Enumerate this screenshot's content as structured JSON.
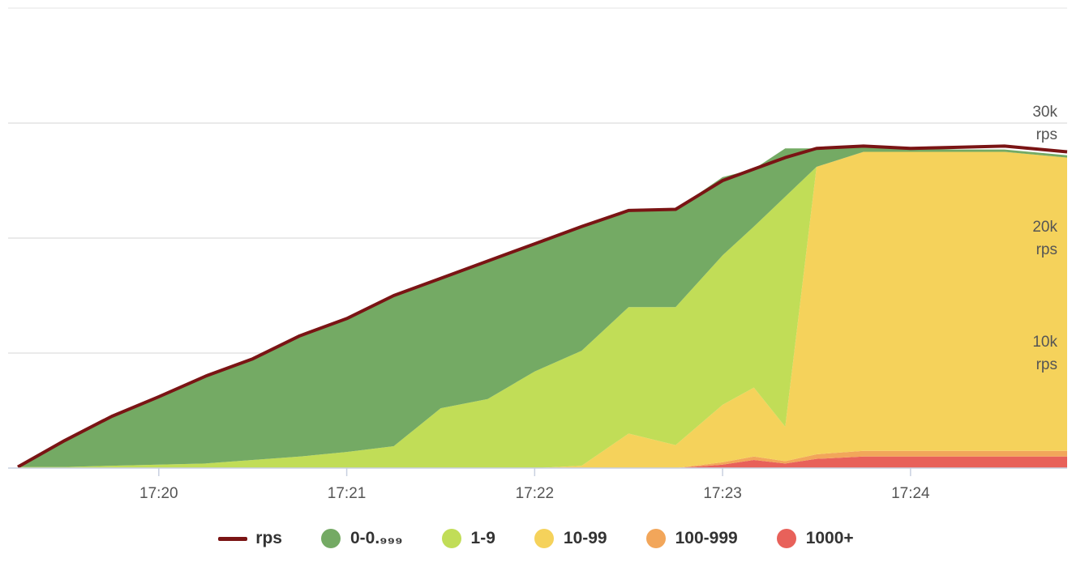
{
  "chart_data": {
    "type": "area",
    "stacked": true,
    "x_ticks": [
      "17:20",
      "17:21",
      "17:22",
      "17:23",
      "17:24"
    ],
    "x_range": [
      "17:19:15",
      "17:24:50"
    ],
    "y_ticks": [
      {
        "value": 10000,
        "line1": "10k",
        "line2": "rps"
      },
      {
        "value": 20000,
        "line1": "20k",
        "line2": "rps"
      },
      {
        "value": 30000,
        "line1": "30k",
        "line2": "rps"
      }
    ],
    "ylim": [
      0,
      40000
    ],
    "grid": true,
    "legend_position": "bottom",
    "line_series": {
      "name": "rps",
      "color": "#7a1414"
    },
    "x": [
      "17:19:15",
      "17:19:30",
      "17:19:45",
      "17:20:00",
      "17:20:15",
      "17:20:30",
      "17:20:45",
      "17:21:00",
      "17:21:15",
      "17:21:30",
      "17:21:45",
      "17:22:00",
      "17:22:15",
      "17:22:30",
      "17:22:45",
      "17:23:00",
      "17:23:10",
      "17:23:20",
      "17:23:30",
      "17:23:45",
      "17:24:00",
      "17:24:15",
      "17:24:30",
      "17:24:50"
    ],
    "series": [
      {
        "name": "1000+",
        "color": "#e8615a",
        "values": [
          0,
          0,
          0,
          0,
          0,
          0,
          0,
          0,
          0,
          0,
          0,
          0,
          0,
          0,
          0,
          300,
          700,
          400,
          800,
          1000,
          1000,
          1000,
          1000,
          1000
        ]
      },
      {
        "name": "100-999",
        "color": "#f2a65a",
        "values": [
          0,
          0,
          0,
          0,
          0,
          0,
          0,
          0,
          0,
          0,
          0,
          0,
          0,
          0,
          0,
          200,
          300,
          200,
          400,
          500,
          500,
          500,
          500,
          500
        ]
      },
      {
        "name": "10-99",
        "color": "#f5d25b",
        "values": [
          0,
          0,
          0,
          0,
          0,
          0,
          0,
          0,
          0,
          0,
          0,
          0,
          200,
          3000,
          2000,
          5000,
          6000,
          3000,
          25000,
          26000,
          26000,
          26000,
          26000,
          25500
        ]
      },
      {
        "name": "1-9",
        "color": "#c1dd57",
        "values": [
          100,
          100,
          200,
          300,
          400,
          700,
          1000,
          1400,
          1900,
          5200,
          6000,
          8400,
          10000,
          11000,
          12000,
          13000,
          14000,
          20000,
          0,
          0,
          0,
          0,
          0,
          0
        ]
      },
      {
        "name": "0-0.999",
        "color": "#74aa64",
        "values": [
          100,
          2300,
          4300,
          5900,
          7600,
          8800,
          10500,
          11600,
          13100,
          11300,
          12000,
          11100,
          10800,
          8400,
          8500,
          6800,
          5000,
          4200,
          1600,
          500,
          300,
          200,
          200,
          200
        ]
      }
    ],
    "rps": [
      100,
      2400,
      4500,
      6200,
      8000,
      9500,
      11500,
      13000,
      15000,
      16500,
      18000,
      19500,
      21000,
      22400,
      22500,
      25000,
      26000,
      27000,
      27800,
      28000,
      27800,
      27900,
      28000,
      27500
    ],
    "legend": [
      "rps",
      "0-0.999",
      "1-9",
      "10-99",
      "100-999",
      "1000+"
    ]
  },
  "legend": {
    "items": [
      {
        "label": "rps",
        "color": "#7a1414",
        "kind": "line"
      },
      {
        "label": "0-0.₉₉₉",
        "color": "#74aa64",
        "kind": "dot"
      },
      {
        "label": "1-9",
        "color": "#c1dd57",
        "kind": "dot"
      },
      {
        "label": "10-99",
        "color": "#f5d25b",
        "kind": "dot"
      },
      {
        "label": "100-999",
        "color": "#f2a65a",
        "kind": "dot"
      },
      {
        "label": "1000+",
        "color": "#e8615a",
        "kind": "dot"
      }
    ]
  }
}
